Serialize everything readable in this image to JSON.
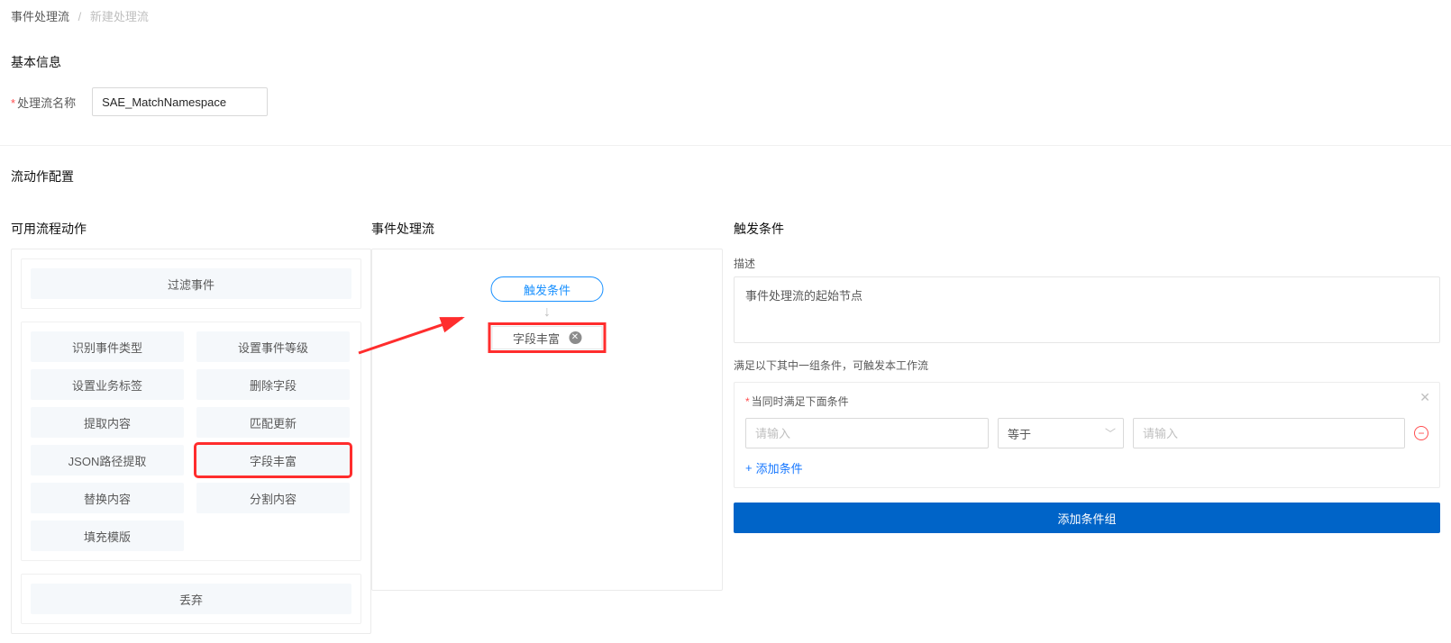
{
  "breadcrumb": {
    "parent": "事件处理流",
    "current": "新建处理流"
  },
  "basic": {
    "title": "基本信息",
    "name_label": "处理流名称",
    "name_value": "SAE_MatchNamespace"
  },
  "flow_config_title": "流动作配置",
  "available": {
    "title": "可用流程动作",
    "group1": [
      {
        "label": "过滤事件",
        "wide": true
      }
    ],
    "group2": [
      {
        "row": [
          {
            "label": "识别事件类型"
          },
          {
            "label": "设置事件等级"
          }
        ]
      },
      {
        "row": [
          {
            "label": "设置业务标签"
          },
          {
            "label": "删除字段"
          }
        ]
      },
      {
        "row": [
          {
            "label": "提取内容"
          },
          {
            "label": "匹配更新"
          }
        ]
      },
      {
        "row": [
          {
            "label": "JSON路径提取"
          },
          {
            "label": "字段丰富",
            "highlight": true
          }
        ]
      },
      {
        "row": [
          {
            "label": "替换内容"
          },
          {
            "label": "分割内容"
          }
        ]
      },
      {
        "row": [
          {
            "label": "填充模版"
          }
        ]
      }
    ],
    "group3": [
      {
        "label": "丢弃",
        "wide": true
      }
    ]
  },
  "flow": {
    "title": "事件处理流",
    "start_node": "触发条件",
    "added_node": "字段丰富"
  },
  "trigger": {
    "title": "触发条件",
    "desc_label": "描述",
    "desc_value": "事件处理流的起始节点",
    "hint": "满足以下其中一组条件，可触发本工作流",
    "group_label": "当同时满足下面条件",
    "field_placeholder": "请输入",
    "op_label": "等于",
    "value_placeholder": "请输入",
    "add_cond": "添加条件",
    "add_group": "添加条件组"
  }
}
